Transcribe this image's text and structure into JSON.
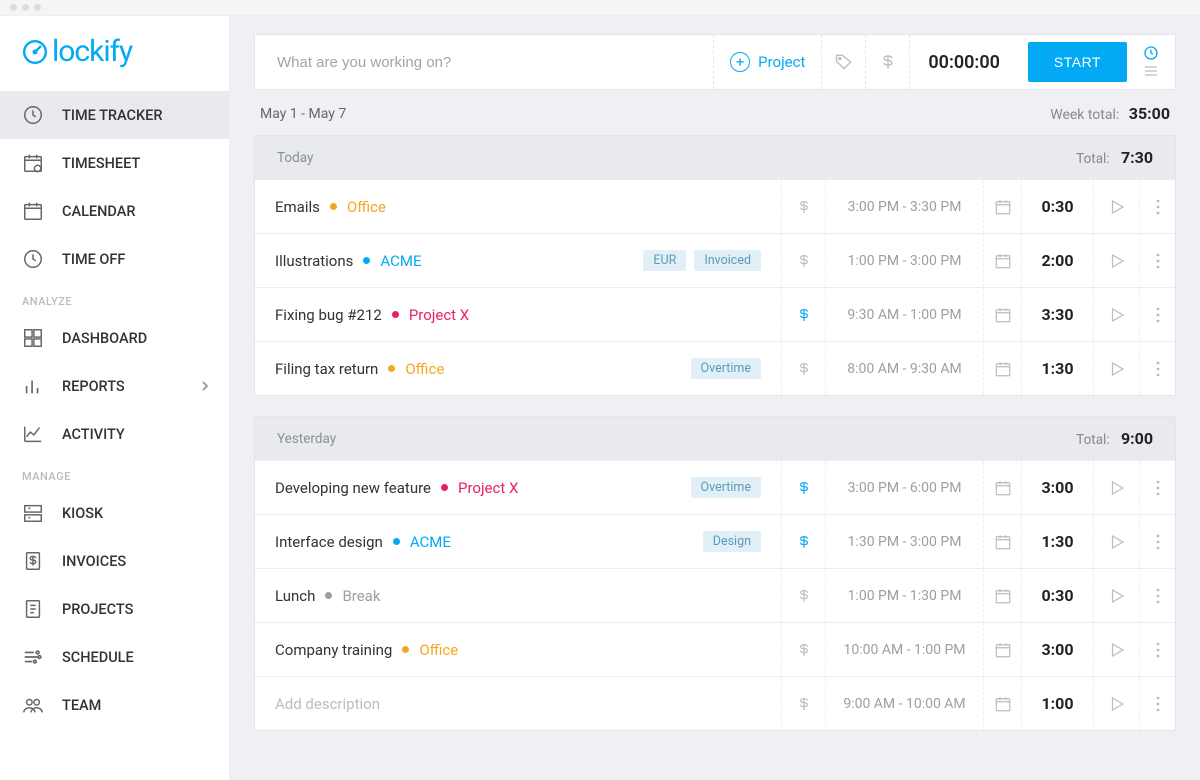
{
  "logo_text": "lockify",
  "sidebar": {
    "items_top": [
      {
        "label": "TIME TRACKER",
        "icon": "clock-icon",
        "active": true
      },
      {
        "label": "TIMESHEET",
        "icon": "timesheet-icon"
      },
      {
        "label": "CALENDAR",
        "icon": "calendar-icon"
      },
      {
        "label": "TIME OFF",
        "icon": "clock-icon"
      }
    ],
    "section_analyze": "ANALYZE",
    "items_analyze": [
      {
        "label": "DASHBOARD",
        "icon": "grid-icon"
      },
      {
        "label": "REPORTS",
        "icon": "bar-chart-icon",
        "chevron": true
      },
      {
        "label": "ACTIVITY",
        "icon": "line-chart-icon"
      }
    ],
    "section_manage": "MANAGE",
    "items_manage": [
      {
        "label": "KIOSK",
        "icon": "kiosk-icon"
      },
      {
        "label": "INVOICES",
        "icon": "invoice-icon"
      },
      {
        "label": "PROJECTS",
        "icon": "document-icon"
      },
      {
        "label": "SCHEDULE",
        "icon": "schedule-icon"
      },
      {
        "label": "TEAM",
        "icon": "team-icon"
      }
    ]
  },
  "tracker": {
    "placeholder": "What are you working on?",
    "project_label": "Project",
    "timer": "00:00:00",
    "start_label": "START"
  },
  "week": {
    "range": "May 1 - May 7",
    "total_label": "Week total:",
    "total": "35:00"
  },
  "projects": {
    "office": {
      "name": "Office",
      "color": "#F5A623"
    },
    "acme": {
      "name": "ACME",
      "color": "#03A9F4"
    },
    "projectx": {
      "name": "Project X",
      "color": "#E91E63"
    },
    "break": {
      "name": "Break",
      "color": "#9E9E9E"
    }
  },
  "groups": [
    {
      "label": "Today",
      "total_label": "Total:",
      "total": "7:30",
      "entries": [
        {
          "title": "Emails",
          "project": "office",
          "tags": [],
          "billable": false,
          "time": "3:00 PM - 3:30 PM",
          "duration": "0:30"
        },
        {
          "title": "Illustrations",
          "project": "acme",
          "tags": [
            "EUR",
            "Invoiced"
          ],
          "billable": false,
          "time": "1:00 PM - 3:00 PM",
          "duration": "2:00"
        },
        {
          "title": "Fixing bug #212",
          "project": "projectx",
          "tags": [],
          "billable": true,
          "time": "9:30 AM - 1:00 PM",
          "duration": "3:30"
        },
        {
          "title": "Filing tax return",
          "project": "office",
          "tags": [
            "Overtime"
          ],
          "billable": false,
          "time": "8:00 AM - 9:30 AM",
          "duration": "1:30"
        }
      ]
    },
    {
      "label": "Yesterday",
      "total_label": "Total:",
      "total": "9:00",
      "entries": [
        {
          "title": "Developing new feature",
          "project": "projectx",
          "tags": [
            "Overtime"
          ],
          "billable": true,
          "time": "3:00 PM - 6:00 PM",
          "duration": "3:00"
        },
        {
          "title": "Interface design",
          "project": "acme",
          "tags": [
            "Design"
          ],
          "billable": true,
          "time": "1:30 PM - 3:00 PM",
          "duration": "1:30"
        },
        {
          "title": "Lunch",
          "project": "break",
          "tags": [],
          "billable": false,
          "time": "1:00 PM - 1:30 PM",
          "duration": "0:30"
        },
        {
          "title": "Company training",
          "project": "office",
          "tags": [],
          "billable": false,
          "time": "10:00 AM - 1:00 PM",
          "duration": "3:00"
        },
        {
          "title": "",
          "placeholder": "Add description",
          "project": null,
          "tags": [],
          "billable": false,
          "time": "9:00 AM - 10:00 AM",
          "duration": "1:00"
        }
      ]
    }
  ]
}
